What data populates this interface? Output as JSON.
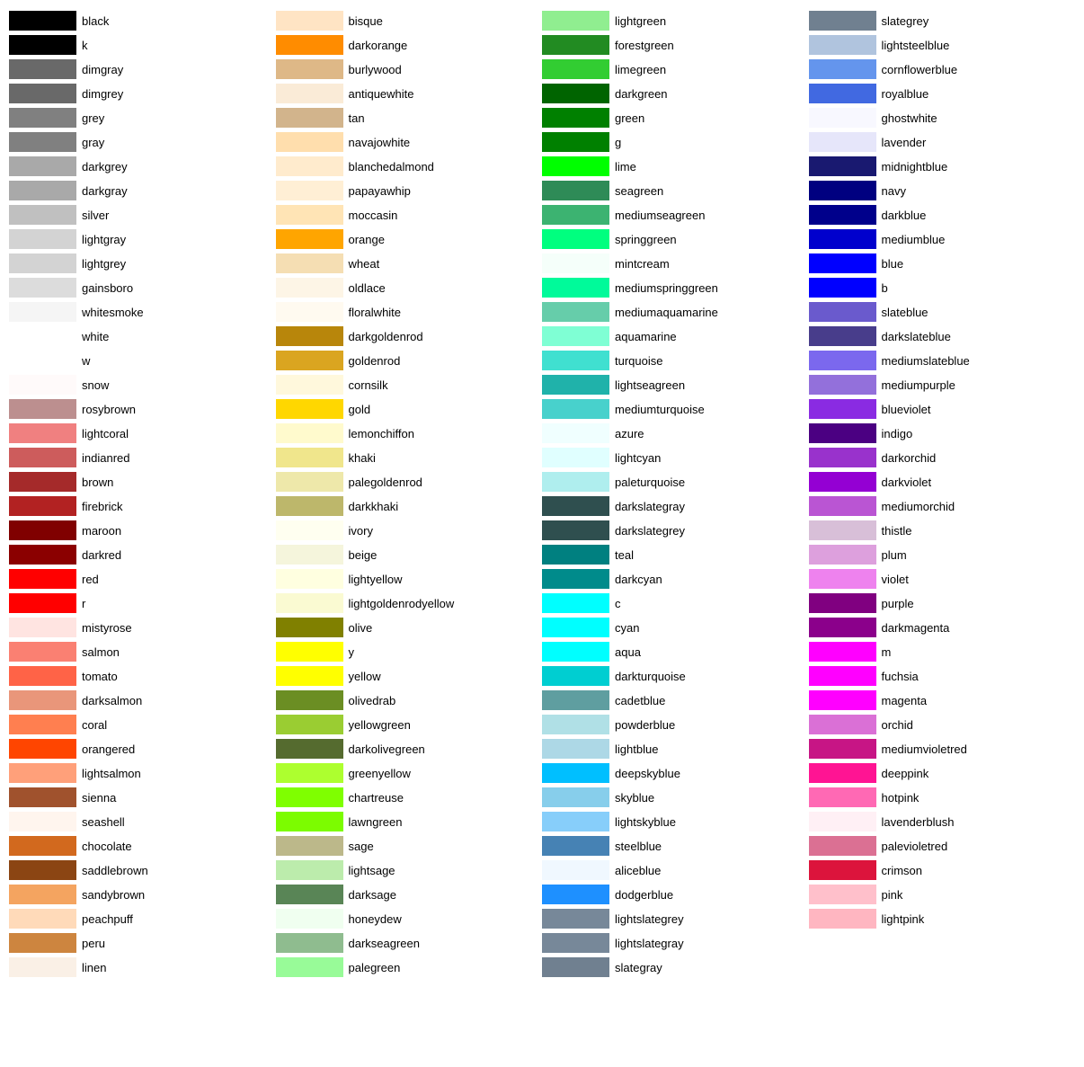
{
  "columns": [
    {
      "id": "col1",
      "items": [
        {
          "name": "black",
          "color": "#000000"
        },
        {
          "name": "k",
          "color": "#000000"
        },
        {
          "name": "dimgray",
          "color": "#696969"
        },
        {
          "name": "dimgrey",
          "color": "#696969"
        },
        {
          "name": "grey",
          "color": "#808080"
        },
        {
          "name": "gray",
          "color": "#808080"
        },
        {
          "name": "darkgrey",
          "color": "#a9a9a9"
        },
        {
          "name": "darkgray",
          "color": "#a9a9a9"
        },
        {
          "name": "silver",
          "color": "#c0c0c0"
        },
        {
          "name": "lightgray",
          "color": "#d3d3d3"
        },
        {
          "name": "lightgrey",
          "color": "#d3d3d3"
        },
        {
          "name": "gainsboro",
          "color": "#dcdcdc"
        },
        {
          "name": "whitesmoke",
          "color": "#f5f5f5"
        },
        {
          "name": "white",
          "color": "#ffffff"
        },
        {
          "name": "w",
          "color": "#ffffff"
        },
        {
          "name": "snow",
          "color": "#fffafa"
        },
        {
          "name": "rosybrown",
          "color": "#bc8f8f"
        },
        {
          "name": "lightcoral",
          "color": "#f08080"
        },
        {
          "name": "indianred",
          "color": "#cd5c5c"
        },
        {
          "name": "brown",
          "color": "#a52a2a"
        },
        {
          "name": "firebrick",
          "color": "#b22222"
        },
        {
          "name": "maroon",
          "color": "#800000"
        },
        {
          "name": "darkred",
          "color": "#8b0000"
        },
        {
          "name": "red",
          "color": "#ff0000"
        },
        {
          "name": "r",
          "color": "#ff0000"
        },
        {
          "name": "mistyrose",
          "color": "#ffe4e1"
        },
        {
          "name": "salmon",
          "color": "#fa8072"
        },
        {
          "name": "tomato",
          "color": "#ff6347"
        },
        {
          "name": "darksalmon",
          "color": "#e9967a"
        },
        {
          "name": "coral",
          "color": "#ff7f50"
        },
        {
          "name": "orangered",
          "color": "#ff4500"
        },
        {
          "name": "lightsalmon",
          "color": "#ffa07a"
        },
        {
          "name": "sienna",
          "color": "#a0522d"
        },
        {
          "name": "seashell",
          "color": "#fff5ee"
        },
        {
          "name": "chocolate",
          "color": "#d2691e"
        },
        {
          "name": "saddlebrown",
          "color": "#8b4513"
        },
        {
          "name": "sandybrown",
          "color": "#f4a460"
        },
        {
          "name": "peachpuff",
          "color": "#ffdab9"
        },
        {
          "name": "peru",
          "color": "#cd853f"
        },
        {
          "name": "linen",
          "color": "#faf0e6"
        }
      ]
    },
    {
      "id": "col2",
      "items": [
        {
          "name": "bisque",
          "color": "#ffe4c4"
        },
        {
          "name": "darkorange",
          "color": "#ff8c00"
        },
        {
          "name": "burlywood",
          "color": "#deb887"
        },
        {
          "name": "antiquewhite",
          "color": "#faebd7"
        },
        {
          "name": "tan",
          "color": "#d2b48c"
        },
        {
          "name": "navajowhite",
          "color": "#ffdead"
        },
        {
          "name": "blanchedalmond",
          "color": "#ffebcd"
        },
        {
          "name": "papayawhip",
          "color": "#ffefd5"
        },
        {
          "name": "moccasin",
          "color": "#ffe4b5"
        },
        {
          "name": "orange",
          "color": "#ffa500"
        },
        {
          "name": "wheat",
          "color": "#f5deb3"
        },
        {
          "name": "oldlace",
          "color": "#fdf5e6"
        },
        {
          "name": "floralwhite",
          "color": "#fffaf0"
        },
        {
          "name": "darkgoldenrod",
          "color": "#b8860b"
        },
        {
          "name": "goldenrod",
          "color": "#daa520"
        },
        {
          "name": "cornsilk",
          "color": "#fff8dc"
        },
        {
          "name": "gold",
          "color": "#ffd700"
        },
        {
          "name": "lemonchiffon",
          "color": "#fffacd"
        },
        {
          "name": "khaki",
          "color": "#f0e68c"
        },
        {
          "name": "palegoldenrod",
          "color": "#eee8aa"
        },
        {
          "name": "darkkhaki",
          "color": "#bdb76b"
        },
        {
          "name": "ivory",
          "color": "#fffff0"
        },
        {
          "name": "beige",
          "color": "#f5f5dc"
        },
        {
          "name": "lightyellow",
          "color": "#ffffe0"
        },
        {
          "name": "lightgoldenrodyellow",
          "color": "#fafad2"
        },
        {
          "name": "olive",
          "color": "#808000"
        },
        {
          "name": "y",
          "color": "#ffff00"
        },
        {
          "name": "yellow",
          "color": "#ffff00"
        },
        {
          "name": "olivedrab",
          "color": "#6b8e23"
        },
        {
          "name": "yellowgreen",
          "color": "#9acd32"
        },
        {
          "name": "darkolivegreen",
          "color": "#556b2f"
        },
        {
          "name": "greenyellow",
          "color": "#adff2f"
        },
        {
          "name": "chartreuse",
          "color": "#7fff00"
        },
        {
          "name": "lawngreen",
          "color": "#7cfc00"
        },
        {
          "name": "sage",
          "color": "#bcb88a"
        },
        {
          "name": "lightsage",
          "color": "#bcecac"
        },
        {
          "name": "darksage",
          "color": "#598556"
        },
        {
          "name": "honeydew",
          "color": "#f0fff0"
        },
        {
          "name": "darkseagreen",
          "color": "#8fbc8f"
        },
        {
          "name": "palegreen",
          "color": "#98fb98"
        }
      ]
    },
    {
      "id": "col3",
      "items": [
        {
          "name": "lightgreen",
          "color": "#90ee90"
        },
        {
          "name": "forestgreen",
          "color": "#228b22"
        },
        {
          "name": "limegreen",
          "color": "#32cd32"
        },
        {
          "name": "darkgreen",
          "color": "#006400"
        },
        {
          "name": "green",
          "color": "#008000"
        },
        {
          "name": "g",
          "color": "#008000"
        },
        {
          "name": "lime",
          "color": "#00ff00"
        },
        {
          "name": "seagreen",
          "color": "#2e8b57"
        },
        {
          "name": "mediumseagreen",
          "color": "#3cb371"
        },
        {
          "name": "springgreen",
          "color": "#00ff7f"
        },
        {
          "name": "mintcream",
          "color": "#f5fffa"
        },
        {
          "name": "mediumspringgreen",
          "color": "#00fa9a"
        },
        {
          "name": "mediumaquamarine",
          "color": "#66cdaa"
        },
        {
          "name": "aquamarine",
          "color": "#7fffd4"
        },
        {
          "name": "turquoise",
          "color": "#40e0d0"
        },
        {
          "name": "lightseagreen",
          "color": "#20b2aa"
        },
        {
          "name": "mediumturquoise",
          "color": "#48d1cc"
        },
        {
          "name": "azure",
          "color": "#f0ffff"
        },
        {
          "name": "lightcyan",
          "color": "#e0ffff"
        },
        {
          "name": "paleturquoise",
          "color": "#afeeee"
        },
        {
          "name": "darkslategray",
          "color": "#2f4f4f"
        },
        {
          "name": "darkslategrey",
          "color": "#2f4f4f"
        },
        {
          "name": "teal",
          "color": "#008080"
        },
        {
          "name": "darkcyan",
          "color": "#008b8b"
        },
        {
          "name": "c",
          "color": "#00ffff"
        },
        {
          "name": "cyan",
          "color": "#00ffff"
        },
        {
          "name": "aqua",
          "color": "#00ffff"
        },
        {
          "name": "darkturquoise",
          "color": "#00ced1"
        },
        {
          "name": "cadetblue",
          "color": "#5f9ea0"
        },
        {
          "name": "powderblue",
          "color": "#b0e0e6"
        },
        {
          "name": "lightblue",
          "color": "#add8e6"
        },
        {
          "name": "deepskyblue",
          "color": "#00bfff"
        },
        {
          "name": "skyblue",
          "color": "#87ceeb"
        },
        {
          "name": "lightskyblue",
          "color": "#87cefa"
        },
        {
          "name": "steelblue",
          "color": "#4682b4"
        },
        {
          "name": "aliceblue",
          "color": "#f0f8ff"
        },
        {
          "name": "dodgerblue",
          "color": "#1e90ff"
        },
        {
          "name": "lightslategrey",
          "color": "#778899"
        },
        {
          "name": "lightslategray",
          "color": "#778899"
        },
        {
          "name": "slategray",
          "color": "#708090"
        }
      ]
    },
    {
      "id": "col4",
      "items": [
        {
          "name": "slategrey",
          "color": "#708090"
        },
        {
          "name": "lightsteelblue",
          "color": "#b0c4de"
        },
        {
          "name": "cornflowerblue",
          "color": "#6495ed"
        },
        {
          "name": "royalblue",
          "color": "#4169e1"
        },
        {
          "name": "ghostwhite",
          "color": "#f8f8ff"
        },
        {
          "name": "lavender",
          "color": "#e6e6fa"
        },
        {
          "name": "midnightblue",
          "color": "#191970"
        },
        {
          "name": "navy",
          "color": "#000080"
        },
        {
          "name": "darkblue",
          "color": "#00008b"
        },
        {
          "name": "mediumblue",
          "color": "#0000cd"
        },
        {
          "name": "blue",
          "color": "#0000ff"
        },
        {
          "name": "b",
          "color": "#0000ff"
        },
        {
          "name": "slateblue",
          "color": "#6a5acd"
        },
        {
          "name": "darkslateblue",
          "color": "#483d8b"
        },
        {
          "name": "mediumslateblue",
          "color": "#7b68ee"
        },
        {
          "name": "mediumpurple",
          "color": "#9370db"
        },
        {
          "name": "blueviolet",
          "color": "#8a2be2"
        },
        {
          "name": "indigo",
          "color": "#4b0082"
        },
        {
          "name": "darkorchid",
          "color": "#9932cc"
        },
        {
          "name": "darkviolet",
          "color": "#9400d3"
        },
        {
          "name": "mediumorchid",
          "color": "#ba55d3"
        },
        {
          "name": "thistle",
          "color": "#d8bfd8"
        },
        {
          "name": "plum",
          "color": "#dda0dd"
        },
        {
          "name": "violet",
          "color": "#ee82ee"
        },
        {
          "name": "purple",
          "color": "#800080"
        },
        {
          "name": "darkmagenta",
          "color": "#8b008b"
        },
        {
          "name": "m",
          "color": "#ff00ff"
        },
        {
          "name": "fuchsia",
          "color": "#ff00ff"
        },
        {
          "name": "magenta",
          "color": "#ff00ff"
        },
        {
          "name": "orchid",
          "color": "#da70d6"
        },
        {
          "name": "mediumvioletred",
          "color": "#c71585"
        },
        {
          "name": "deeppink",
          "color": "#ff1493"
        },
        {
          "name": "hotpink",
          "color": "#ff69b4"
        },
        {
          "name": "lavenderblush",
          "color": "#fff0f5"
        },
        {
          "name": "palevioletred",
          "color": "#db7093"
        },
        {
          "name": "crimson",
          "color": "#dc143c"
        },
        {
          "name": "pink",
          "color": "#ffc0cb"
        },
        {
          "name": "lightpink",
          "color": "#ffb6c1"
        }
      ]
    }
  ]
}
